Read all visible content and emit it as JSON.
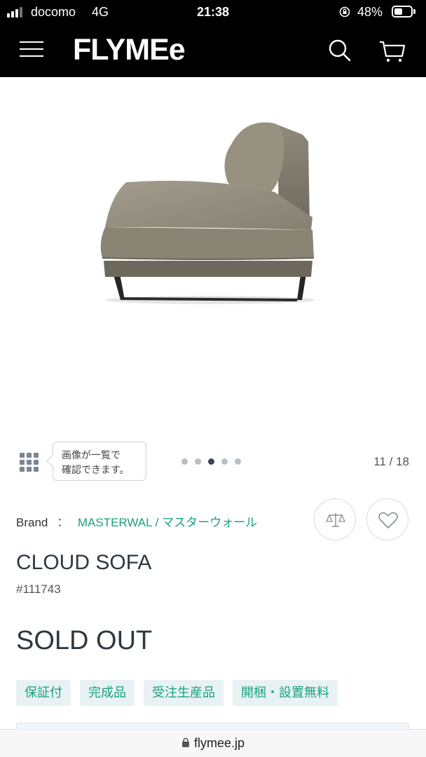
{
  "status_bar": {
    "carrier": "docomo",
    "network": "4G",
    "time": "21:38",
    "battery_percent": "48%",
    "battery_level": 0.48
  },
  "header": {
    "logo": "FLYMEe",
    "menu_icon": "hamburger-menu-icon",
    "search_icon": "search-icon",
    "cart_icon": "cart-icon"
  },
  "gallery": {
    "image_alt": "sofa-product-image",
    "grid_icon": "grid-icon",
    "tooltip_line1": "画像が一覧で",
    "tooltip_line2": "確認できます。",
    "dots_count": 5,
    "active_dot": 2,
    "counter": "11 / 18"
  },
  "product": {
    "brand_label": "Brand",
    "brand_separator": "：",
    "brand_name": "MASTERWAL / マスターウォール",
    "compare_icon": "compare-scale-icon",
    "favorite_icon": "heart-icon",
    "name": "CLOUD SOFA",
    "code": "#111743",
    "status": "SOLD OUT",
    "tags": [
      "保証付",
      "完成品",
      "受注生産品",
      "開梱・設置無料"
    ]
  },
  "browser": {
    "url": "flymee.jp"
  },
  "colors": {
    "accent": "#1aa07f",
    "header_bg": "#000000",
    "tag_bg": "#e8f2f5"
  }
}
